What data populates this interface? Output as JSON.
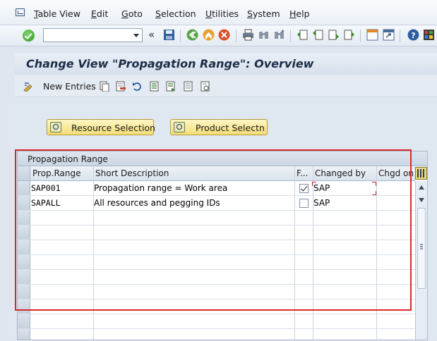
{
  "menu": {
    "items": [
      "Table View",
      "Edit",
      "Goto",
      "Selection",
      "Utilities",
      "System",
      "Help"
    ]
  },
  "toolbar": {
    "command_value": "",
    "icons": [
      "enter-icon",
      "save-icon",
      "back-icon",
      "exit-icon",
      "cancel-icon",
      "print-icon",
      "find-icon",
      "find-next-icon",
      "first-page-icon",
      "previous-page-icon",
      "next-page-icon",
      "last-page-icon",
      "create-session-icon",
      "shortcut-icon",
      "help-icon",
      "customize-layout-icon"
    ]
  },
  "page": {
    "title": "Change View \"Propagation Range\": Overview"
  },
  "app_toolbar": {
    "new_entries": "New Entries"
  },
  "buttons": {
    "resource_selection": "Resource Selection",
    "product_selection": "Product Selectn"
  },
  "table": {
    "title": "Propagation Range",
    "headers": {
      "prop_range": "Prop.Range",
      "short_description": "Short Description",
      "flag": "F...",
      "changed_by": "Changed by",
      "changed_on": "Chgd on"
    },
    "rows": [
      {
        "prop_range": "SAP001",
        "short_description": "Propagation range = Work area",
        "flag_checked": true,
        "changed_by": "SAP",
        "changed_on": ""
      },
      {
        "prop_range": "SAPALL",
        "short_description": "All resources and pegging IDs",
        "flag_checked": false,
        "changed_by": "SAP",
        "changed_on": ""
      }
    ]
  },
  "colors": {
    "highlight": "#d62a2a",
    "button": "#f3dd77",
    "title": "#1c2d46"
  }
}
